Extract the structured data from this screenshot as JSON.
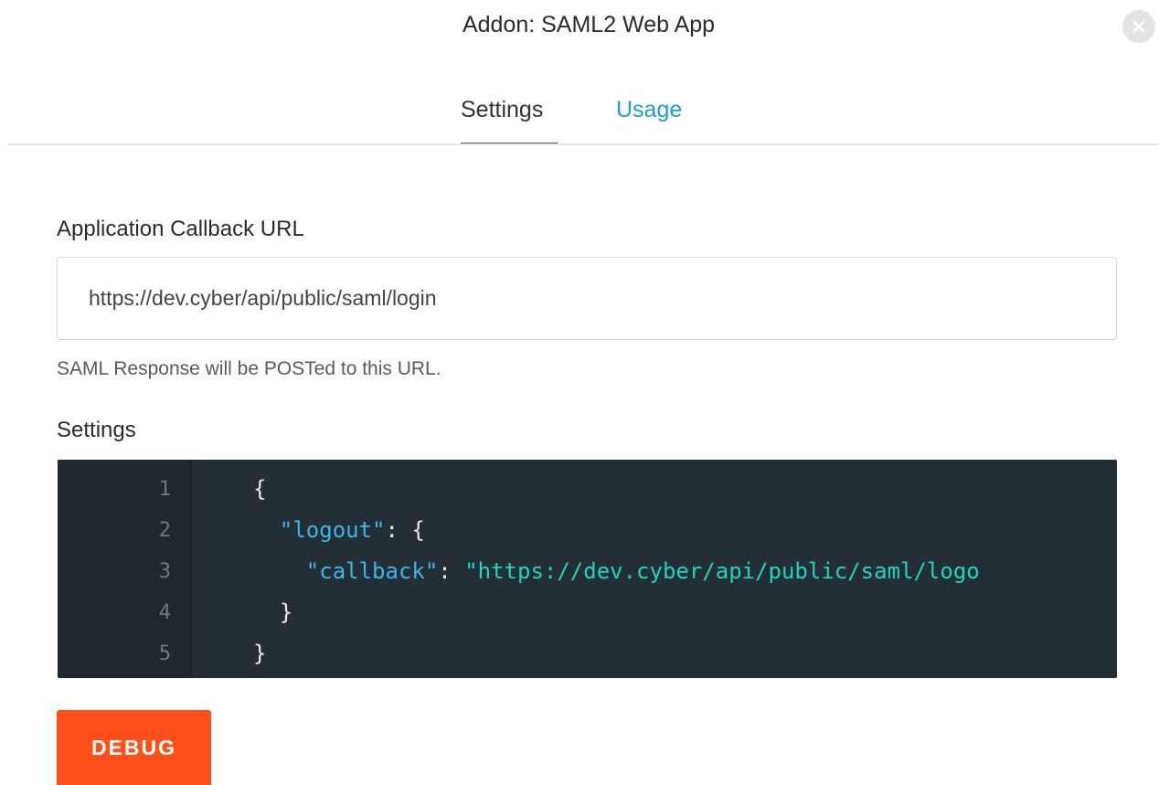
{
  "dialog": {
    "title": "Addon: SAML2 Web App",
    "close_icon": "close-icon"
  },
  "tabs": [
    {
      "label": "Settings",
      "active": true
    },
    {
      "label": "Usage",
      "active": false
    }
  ],
  "callback": {
    "label": "Application Callback URL",
    "value": "https://dev.cyber/api/public/saml/login",
    "help": "SAML Response will be POSTed to this URL."
  },
  "settings": {
    "label": "Settings",
    "lines": [
      {
        "num": "1",
        "code": "{"
      },
      {
        "num": "2",
        "code": "  \"logout\": {"
      },
      {
        "num": "3",
        "code": "    \"callback\": \"https://dev.cyber/api/public/saml/logo"
      },
      {
        "num": "4",
        "code": "  }"
      },
      {
        "num": "5",
        "code": "}"
      }
    ]
  },
  "actions": {
    "debug_label": "DEBUG"
  },
  "colors": {
    "accent_link": "#1e9ecf",
    "debug_button": "#ff4f1a",
    "editor_bg": "#232e35",
    "json_key": "#3bb6e8",
    "json_string": "#20d4c0"
  }
}
